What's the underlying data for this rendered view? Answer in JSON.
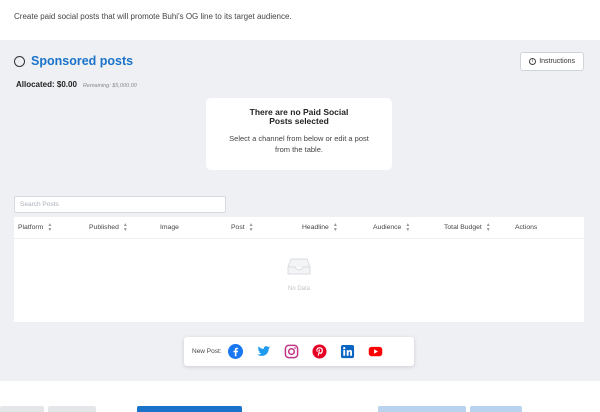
{
  "description": "Create paid social posts that will promote Buhi's OG line to its target audience.",
  "panel": {
    "title": "Sponsored posts",
    "instructions_label": "Instructions",
    "allocated": "Allocated: $0.00",
    "remaining": "Remaining: $5,000.00"
  },
  "empty_card": {
    "title": "There are no Paid Social Posts selected",
    "subtitle": "Select a channel from below or edit a post from the table."
  },
  "search": {
    "placeholder": "Search Posts"
  },
  "table": {
    "columns": [
      {
        "label": "Platform",
        "sortable": true
      },
      {
        "label": "Published",
        "sortable": true
      },
      {
        "label": "Image",
        "sortable": false
      },
      {
        "label": "Post",
        "sortable": true
      },
      {
        "label": "Headline",
        "sortable": true
      },
      {
        "label": "Audience",
        "sortable": true
      },
      {
        "label": "Total Budget",
        "sortable": true
      },
      {
        "label": "Actions",
        "sortable": false
      }
    ],
    "empty_text": "No Data"
  },
  "new_post": {
    "label": "New Post:",
    "platforms": [
      "facebook",
      "twitter",
      "instagram",
      "pinterest",
      "linkedin",
      "youtube"
    ]
  },
  "colors": {
    "accent": "#1a73c9",
    "facebook": "#1877f2",
    "twitter": "#1d9bf0",
    "instagram": "#c13584",
    "pinterest": "#e60023",
    "linkedin": "#0a66c2",
    "youtube": "#ff0000"
  }
}
